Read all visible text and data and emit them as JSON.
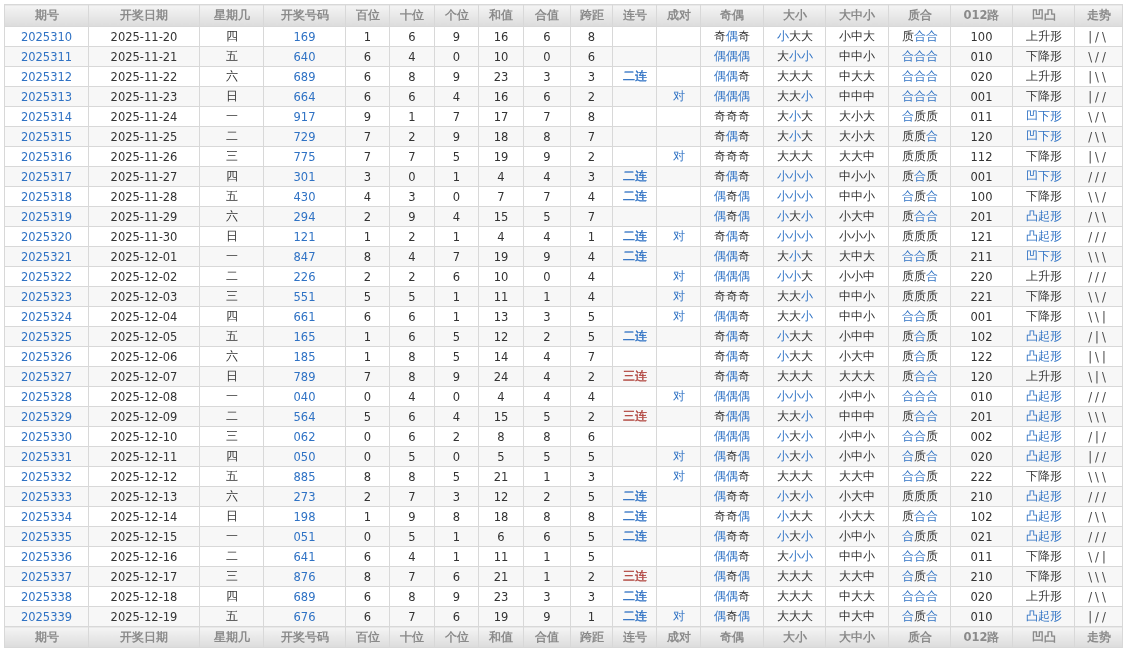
{
  "columns": [
    "期号",
    "开奖日期",
    "星期几",
    "开奖号码",
    "百位",
    "十位",
    "个位",
    "和值",
    "合值",
    "跨距",
    "连号",
    "成对",
    "奇偶",
    "大小",
    "大中小",
    "质合",
    "012路",
    "凹凸",
    "走势"
  ],
  "rows": [
    {
      "issue": "2025310",
      "date": "2025-11-20",
      "weekday": "四",
      "number": "169",
      "hundreds": "1",
      "tens": "6",
      "ones": "9",
      "sum": "16",
      "sum_tail": "6",
      "span": "8",
      "parity": [
        "奇",
        "偶",
        "奇"
      ],
      "parity_hl": [
        false,
        true,
        false
      ],
      "size": [
        "小",
        "大",
        "大"
      ],
      "size_hl": [
        true,
        false,
        false
      ],
      "big_mid_small": "小中大",
      "prime": [
        "质",
        "合",
        "合"
      ],
      "prime_hl": [
        false,
        true,
        true
      ],
      "road": "100",
      "shape": "上升形",
      "shape_hl": false,
      "trend": "|/\\"
    },
    {
      "issue": "2025311",
      "date": "2025-11-21",
      "weekday": "五",
      "number": "640",
      "hundreds": "6",
      "tens": "4",
      "ones": "0",
      "sum": "10",
      "sum_tail": "0",
      "span": "6",
      "parity": [
        "偶",
        "偶",
        "偶"
      ],
      "parity_hl": [
        true,
        true,
        true
      ],
      "size": [
        "大",
        "小",
        "小"
      ],
      "size_hl": [
        false,
        true,
        true
      ],
      "big_mid_small": "中中小",
      "prime": [
        "合",
        "合",
        "合"
      ],
      "prime_hl": [
        true,
        true,
        true
      ],
      "road": "010",
      "shape": "下降形",
      "shape_hl": false,
      "trend": "\\//"
    },
    {
      "issue": "2025312",
      "date": "2025-11-22",
      "weekday": "六",
      "number": "689",
      "hundreds": "6",
      "tens": "8",
      "ones": "9",
      "sum": "23",
      "sum_tail": "3",
      "span": "3",
      "consecutive": {
        "text": "二连",
        "color": "#2f72c4"
      },
      "parity": [
        "偶",
        "偶",
        "奇"
      ],
      "parity_hl": [
        true,
        true,
        false
      ],
      "size": [
        "大",
        "大",
        "大"
      ],
      "size_hl": [
        false,
        false,
        false
      ],
      "big_mid_small": "中大大",
      "prime": [
        "合",
        "合",
        "合"
      ],
      "prime_hl": [
        true,
        true,
        true
      ],
      "road": "020",
      "shape": "上升形",
      "shape_hl": false,
      "trend": "|\\\\"
    },
    {
      "issue": "2025313",
      "date": "2025-11-23",
      "weekday": "日",
      "number": "664",
      "hundreds": "6",
      "tens": "6",
      "ones": "4",
      "sum": "16",
      "sum_tail": "6",
      "span": "2",
      "pair": "对",
      "parity": [
        "偶",
        "偶",
        "偶"
      ],
      "parity_hl": [
        true,
        true,
        true
      ],
      "size": [
        "大",
        "大",
        "小"
      ],
      "size_hl": [
        false,
        false,
        true
      ],
      "big_mid_small": "中中中",
      "prime": [
        "合",
        "合",
        "合"
      ],
      "prime_hl": [
        true,
        true,
        true
      ],
      "road": "001",
      "shape": "下降形",
      "shape_hl": false,
      "trend": "|//"
    },
    {
      "issue": "2025314",
      "date": "2025-11-24",
      "weekday": "一",
      "number": "917",
      "hundreds": "9",
      "tens": "1",
      "ones": "7",
      "sum": "17",
      "sum_tail": "7",
      "span": "8",
      "parity": [
        "奇",
        "奇",
        "奇"
      ],
      "parity_hl": [
        false,
        false,
        false
      ],
      "size": [
        "大",
        "小",
        "大"
      ],
      "size_hl": [
        false,
        true,
        false
      ],
      "big_mid_small": "大小大",
      "prime": [
        "合",
        "质",
        "质"
      ],
      "prime_hl": [
        true,
        false,
        false
      ],
      "road": "011",
      "shape": "凹下形",
      "shape_hl": true,
      "trend": "\\/\\"
    },
    {
      "issue": "2025315",
      "date": "2025-11-25",
      "weekday": "二",
      "number": "729",
      "hundreds": "7",
      "tens": "2",
      "ones": "9",
      "sum": "18",
      "sum_tail": "8",
      "span": "7",
      "parity": [
        "奇",
        "偶",
        "奇"
      ],
      "parity_hl": [
        false,
        true,
        false
      ],
      "size": [
        "大",
        "小",
        "大"
      ],
      "size_hl": [
        false,
        true,
        false
      ],
      "big_mid_small": "大小大",
      "prime": [
        "质",
        "质",
        "合"
      ],
      "prime_hl": [
        false,
        false,
        true
      ],
      "road": "120",
      "shape": "凹下形",
      "shape_hl": true,
      "trend": "/\\\\"
    },
    {
      "issue": "2025316",
      "date": "2025-11-26",
      "weekday": "三",
      "number": "775",
      "hundreds": "7",
      "tens": "7",
      "ones": "5",
      "sum": "19",
      "sum_tail": "9",
      "span": "2",
      "pair": "对",
      "parity": [
        "奇",
        "奇",
        "奇"
      ],
      "parity_hl": [
        false,
        false,
        false
      ],
      "size": [
        "大",
        "大",
        "大"
      ],
      "size_hl": [
        false,
        false,
        false
      ],
      "big_mid_small": "大大中",
      "prime": [
        "质",
        "质",
        "质"
      ],
      "prime_hl": [
        false,
        false,
        false
      ],
      "road": "112",
      "shape": "下降形",
      "shape_hl": false,
      "trend": "|\\/"
    },
    {
      "issue": "2025317",
      "date": "2025-11-27",
      "weekday": "四",
      "number": "301",
      "hundreds": "3",
      "tens": "0",
      "ones": "1",
      "sum": "4",
      "sum_tail": "4",
      "span": "3",
      "consecutive": {
        "text": "二连",
        "color": "#2f72c4"
      },
      "parity": [
        "奇",
        "偶",
        "奇"
      ],
      "parity_hl": [
        false,
        true,
        false
      ],
      "size": [
        "小",
        "小",
        "小"
      ],
      "size_hl": [
        true,
        true,
        true
      ],
      "big_mid_small": "中小小",
      "prime": [
        "质",
        "合",
        "质"
      ],
      "prime_hl": [
        false,
        true,
        false
      ],
      "road": "001",
      "shape": "凹下形",
      "shape_hl": true,
      "trend": "///"
    },
    {
      "issue": "2025318",
      "date": "2025-11-28",
      "weekday": "五",
      "number": "430",
      "hundreds": "4",
      "tens": "3",
      "ones": "0",
      "sum": "7",
      "sum_tail": "7",
      "span": "4",
      "consecutive": {
        "text": "二连",
        "color": "#2f72c4"
      },
      "parity": [
        "偶",
        "奇",
        "偶"
      ],
      "parity_hl": [
        true,
        false,
        true
      ],
      "size": [
        "小",
        "小",
        "小"
      ],
      "size_hl": [
        true,
        true,
        true
      ],
      "big_mid_small": "中中小",
      "prime": [
        "合",
        "质",
        "合"
      ],
      "prime_hl": [
        true,
        false,
        true
      ],
      "road": "100",
      "shape": "下降形",
      "shape_hl": false,
      "trend": "\\\\/"
    },
    {
      "issue": "2025319",
      "date": "2025-11-29",
      "weekday": "六",
      "number": "294",
      "hundreds": "2",
      "tens": "9",
      "ones": "4",
      "sum": "15",
      "sum_tail": "5",
      "span": "7",
      "parity": [
        "偶",
        "奇",
        "偶"
      ],
      "parity_hl": [
        true,
        false,
        true
      ],
      "size": [
        "小",
        "大",
        "小"
      ],
      "size_hl": [
        true,
        false,
        true
      ],
      "big_mid_small": "小大中",
      "prime": [
        "质",
        "合",
        "合"
      ],
      "prime_hl": [
        false,
        true,
        true
      ],
      "road": "201",
      "shape": "凸起形",
      "shape_hl": true,
      "trend": "/\\\\"
    },
    {
      "issue": "2025320",
      "date": "2025-11-30",
      "weekday": "日",
      "number": "121",
      "hundreds": "1",
      "tens": "2",
      "ones": "1",
      "sum": "4",
      "sum_tail": "4",
      "span": "1",
      "consecutive": {
        "text": "二连",
        "color": "#2f72c4"
      },
      "pair": "对",
      "parity": [
        "奇",
        "偶",
        "奇"
      ],
      "parity_hl": [
        false,
        true,
        false
      ],
      "size": [
        "小",
        "小",
        "小"
      ],
      "size_hl": [
        true,
        true,
        true
      ],
      "big_mid_small": "小小小",
      "prime": [
        "质",
        "质",
        "质"
      ],
      "prime_hl": [
        false,
        false,
        false
      ],
      "road": "121",
      "shape": "凸起形",
      "shape_hl": true,
      "trend": "///"
    },
    {
      "issue": "2025321",
      "date": "2025-12-01",
      "weekday": "一",
      "number": "847",
      "hundreds": "8",
      "tens": "4",
      "ones": "7",
      "sum": "19",
      "sum_tail": "9",
      "span": "4",
      "consecutive": {
        "text": "二连",
        "color": "#2f72c4"
      },
      "parity": [
        "偶",
        "偶",
        "奇"
      ],
      "parity_hl": [
        true,
        true,
        false
      ],
      "size": [
        "大",
        "小",
        "大"
      ],
      "size_hl": [
        false,
        true,
        false
      ],
      "big_mid_small": "大中大",
      "prime": [
        "合",
        "合",
        "质"
      ],
      "prime_hl": [
        true,
        true,
        false
      ],
      "road": "211",
      "shape": "凹下形",
      "shape_hl": true,
      "trend": "\\\\\\"
    },
    {
      "issue": "2025322",
      "date": "2025-12-02",
      "weekday": "二",
      "number": "226",
      "hundreds": "2",
      "tens": "2",
      "ones": "6",
      "sum": "10",
      "sum_tail": "0",
      "span": "4",
      "pair": "对",
      "parity": [
        "偶",
        "偶",
        "偶"
      ],
      "parity_hl": [
        true,
        true,
        true
      ],
      "size": [
        "小",
        "小",
        "大"
      ],
      "size_hl": [
        true,
        true,
        false
      ],
      "big_mid_small": "小小中",
      "prime": [
        "质",
        "质",
        "合"
      ],
      "prime_hl": [
        false,
        false,
        true
      ],
      "road": "220",
      "shape": "上升形",
      "shape_hl": false,
      "trend": "///"
    },
    {
      "issue": "2025323",
      "date": "2025-12-03",
      "weekday": "三",
      "number": "551",
      "hundreds": "5",
      "tens": "5",
      "ones": "1",
      "sum": "11",
      "sum_tail": "1",
      "span": "4",
      "pair": "对",
      "parity": [
        "奇",
        "奇",
        "奇"
      ],
      "parity_hl": [
        false,
        false,
        false
      ],
      "size": [
        "大",
        "大",
        "小"
      ],
      "size_hl": [
        false,
        false,
        true
      ],
      "big_mid_small": "中中小",
      "prime": [
        "质",
        "质",
        "质"
      ],
      "prime_hl": [
        false,
        false,
        false
      ],
      "road": "221",
      "shape": "下降形",
      "shape_hl": false,
      "trend": "\\\\/"
    },
    {
      "issue": "2025324",
      "date": "2025-12-04",
      "weekday": "四",
      "number": "661",
      "hundreds": "6",
      "tens": "6",
      "ones": "1",
      "sum": "13",
      "sum_tail": "3",
      "span": "5",
      "pair": "对",
      "parity": [
        "偶",
        "偶",
        "奇"
      ],
      "parity_hl": [
        true,
        true,
        false
      ],
      "size": [
        "大",
        "大",
        "小"
      ],
      "size_hl": [
        false,
        false,
        true
      ],
      "big_mid_small": "中中小",
      "prime": [
        "合",
        "合",
        "质"
      ],
      "prime_hl": [
        true,
        true,
        false
      ],
      "road": "001",
      "shape": "下降形",
      "shape_hl": false,
      "trend": "\\\\|"
    },
    {
      "issue": "2025325",
      "date": "2025-12-05",
      "weekday": "五",
      "number": "165",
      "hundreds": "1",
      "tens": "6",
      "ones": "5",
      "sum": "12",
      "sum_tail": "2",
      "span": "5",
      "consecutive": {
        "text": "二连",
        "color": "#2f72c4"
      },
      "parity": [
        "奇",
        "偶",
        "奇"
      ],
      "parity_hl": [
        false,
        true,
        false
      ],
      "size": [
        "小",
        "大",
        "大"
      ],
      "size_hl": [
        true,
        false,
        false
      ],
      "big_mid_small": "小中中",
      "prime": [
        "质",
        "合",
        "质"
      ],
      "prime_hl": [
        false,
        true,
        false
      ],
      "road": "102",
      "shape": "凸起形",
      "shape_hl": true,
      "trend": "/|\\"
    },
    {
      "issue": "2025326",
      "date": "2025-12-06",
      "weekday": "六",
      "number": "185",
      "hundreds": "1",
      "tens": "8",
      "ones": "5",
      "sum": "14",
      "sum_tail": "4",
      "span": "7",
      "parity": [
        "奇",
        "偶",
        "奇"
      ],
      "parity_hl": [
        false,
        true,
        false
      ],
      "size": [
        "小",
        "大",
        "大"
      ],
      "size_hl": [
        true,
        false,
        false
      ],
      "big_mid_small": "小大中",
      "prime": [
        "质",
        "合",
        "质"
      ],
      "prime_hl": [
        false,
        true,
        false
      ],
      "road": "122",
      "shape": "凸起形",
      "shape_hl": true,
      "trend": "|\\|"
    },
    {
      "issue": "2025327",
      "date": "2025-12-07",
      "weekday": "日",
      "number": "789",
      "hundreds": "7",
      "tens": "8",
      "ones": "9",
      "sum": "24",
      "sum_tail": "4",
      "span": "2",
      "consecutive": {
        "text": "三连",
        "color": "#b0443e"
      },
      "parity": [
        "奇",
        "偶",
        "奇"
      ],
      "parity_hl": [
        false,
        true,
        false
      ],
      "size": [
        "大",
        "大",
        "大"
      ],
      "size_hl": [
        false,
        false,
        false
      ],
      "big_mid_small": "大大大",
      "prime": [
        "质",
        "合",
        "合"
      ],
      "prime_hl": [
        false,
        true,
        true
      ],
      "road": "120",
      "shape": "上升形",
      "shape_hl": false,
      "trend": "\\|\\"
    },
    {
      "issue": "2025328",
      "date": "2025-12-08",
      "weekday": "一",
      "number": "040",
      "hundreds": "0",
      "tens": "4",
      "ones": "0",
      "sum": "4",
      "sum_tail": "4",
      "span": "4",
      "pair": "对",
      "parity": [
        "偶",
        "偶",
        "偶"
      ],
      "parity_hl": [
        true,
        true,
        true
      ],
      "size": [
        "小",
        "小",
        "小"
      ],
      "size_hl": [
        true,
        true,
        true
      ],
      "big_mid_small": "小中小",
      "prime": [
        "合",
        "合",
        "合"
      ],
      "prime_hl": [
        true,
        true,
        true
      ],
      "road": "010",
      "shape": "凸起形",
      "shape_hl": true,
      "trend": "///"
    },
    {
      "issue": "2025329",
      "date": "2025-12-09",
      "weekday": "二",
      "number": "564",
      "hundreds": "5",
      "tens": "6",
      "ones": "4",
      "sum": "15",
      "sum_tail": "5",
      "span": "2",
      "consecutive": {
        "text": "三连",
        "color": "#b0443e"
      },
      "parity": [
        "奇",
        "偶",
        "偶"
      ],
      "parity_hl": [
        false,
        true,
        true
      ],
      "size": [
        "大",
        "大",
        "小"
      ],
      "size_hl": [
        false,
        false,
        true
      ],
      "big_mid_small": "中中中",
      "prime": [
        "质",
        "合",
        "合"
      ],
      "prime_hl": [
        false,
        true,
        true
      ],
      "road": "201",
      "shape": "凸起形",
      "shape_hl": true,
      "trend": "\\\\\\"
    },
    {
      "issue": "2025330",
      "date": "2025-12-10",
      "weekday": "三",
      "number": "062",
      "hundreds": "0",
      "tens": "6",
      "ones": "2",
      "sum": "8",
      "sum_tail": "8",
      "span": "6",
      "parity": [
        "偶",
        "偶",
        "偶"
      ],
      "parity_hl": [
        true,
        true,
        true
      ],
      "size": [
        "小",
        "大",
        "小"
      ],
      "size_hl": [
        true,
        false,
        true
      ],
      "big_mid_small": "小中小",
      "prime": [
        "合",
        "合",
        "质"
      ],
      "prime_hl": [
        true,
        true,
        false
      ],
      "road": "002",
      "shape": "凸起形",
      "shape_hl": true,
      "trend": "/|/"
    },
    {
      "issue": "2025331",
      "date": "2025-12-11",
      "weekday": "四",
      "number": "050",
      "hundreds": "0",
      "tens": "5",
      "ones": "0",
      "sum": "5",
      "sum_tail": "5",
      "span": "5",
      "pair": "对",
      "parity": [
        "偶",
        "奇",
        "偶"
      ],
      "parity_hl": [
        true,
        false,
        true
      ],
      "size": [
        "小",
        "大",
        "小"
      ],
      "size_hl": [
        true,
        false,
        true
      ],
      "big_mid_small": "小中小",
      "prime": [
        "合",
        "质",
        "合"
      ],
      "prime_hl": [
        true,
        false,
        true
      ],
      "road": "020",
      "shape": "凸起形",
      "shape_hl": true,
      "trend": "|//"
    },
    {
      "issue": "2025332",
      "date": "2025-12-12",
      "weekday": "五",
      "number": "885",
      "hundreds": "8",
      "tens": "8",
      "ones": "5",
      "sum": "21",
      "sum_tail": "1",
      "span": "3",
      "pair": "对",
      "parity": [
        "偶",
        "偶",
        "奇"
      ],
      "parity_hl": [
        true,
        true,
        false
      ],
      "size": [
        "大",
        "大",
        "大"
      ],
      "size_hl": [
        false,
        false,
        false
      ],
      "big_mid_small": "大大中",
      "prime": [
        "合",
        "合",
        "质"
      ],
      "prime_hl": [
        true,
        true,
        false
      ],
      "road": "222",
      "shape": "下降形",
      "shape_hl": false,
      "trend": "\\\\\\"
    },
    {
      "issue": "2025333",
      "date": "2025-12-13",
      "weekday": "六",
      "number": "273",
      "hundreds": "2",
      "tens": "7",
      "ones": "3",
      "sum": "12",
      "sum_tail": "2",
      "span": "5",
      "consecutive": {
        "text": "二连",
        "color": "#2f72c4"
      },
      "parity": [
        "偶",
        "奇",
        "奇"
      ],
      "parity_hl": [
        true,
        false,
        false
      ],
      "size": [
        "小",
        "大",
        "小"
      ],
      "size_hl": [
        true,
        false,
        true
      ],
      "big_mid_small": "小大中",
      "prime": [
        "质",
        "质",
        "质"
      ],
      "prime_hl": [
        false,
        false,
        false
      ],
      "road": "210",
      "shape": "凸起形",
      "shape_hl": true,
      "trend": "///"
    },
    {
      "issue": "2025334",
      "date": "2025-12-14",
      "weekday": "日",
      "number": "198",
      "hundreds": "1",
      "tens": "9",
      "ones": "8",
      "sum": "18",
      "sum_tail": "8",
      "span": "8",
      "consecutive": {
        "text": "二连",
        "color": "#2f72c4"
      },
      "parity": [
        "奇",
        "奇",
        "偶"
      ],
      "parity_hl": [
        false,
        false,
        true
      ],
      "size": [
        "小",
        "大",
        "大"
      ],
      "size_hl": [
        true,
        false,
        false
      ],
      "big_mid_small": "小大大",
      "prime": [
        "质",
        "合",
        "合"
      ],
      "prime_hl": [
        false,
        true,
        true
      ],
      "road": "102",
      "shape": "凸起形",
      "shape_hl": true,
      "trend": "/\\\\"
    },
    {
      "issue": "2025335",
      "date": "2025-12-15",
      "weekday": "一",
      "number": "051",
      "hundreds": "0",
      "tens": "5",
      "ones": "1",
      "sum": "6",
      "sum_tail": "6",
      "span": "5",
      "consecutive": {
        "text": "二连",
        "color": "#2f72c4"
      },
      "parity": [
        "偶",
        "奇",
        "奇"
      ],
      "parity_hl": [
        true,
        false,
        false
      ],
      "size": [
        "小",
        "大",
        "小"
      ],
      "size_hl": [
        true,
        false,
        true
      ],
      "big_mid_small": "小中小",
      "prime": [
        "合",
        "质",
        "质"
      ],
      "prime_hl": [
        true,
        false,
        false
      ],
      "road": "021",
      "shape": "凸起形",
      "shape_hl": true,
      "trend": "///"
    },
    {
      "issue": "2025336",
      "date": "2025-12-16",
      "weekday": "二",
      "number": "641",
      "hundreds": "6",
      "tens": "4",
      "ones": "1",
      "sum": "11",
      "sum_tail": "1",
      "span": "5",
      "parity": [
        "偶",
        "偶",
        "奇"
      ],
      "parity_hl": [
        true,
        true,
        false
      ],
      "size": [
        "大",
        "小",
        "小"
      ],
      "size_hl": [
        false,
        true,
        true
      ],
      "big_mid_small": "中中小",
      "prime": [
        "合",
        "合",
        "质"
      ],
      "prime_hl": [
        true,
        true,
        false
      ],
      "road": "011",
      "shape": "下降形",
      "shape_hl": false,
      "trend": "\\/|"
    },
    {
      "issue": "2025337",
      "date": "2025-12-17",
      "weekday": "三",
      "number": "876",
      "hundreds": "8",
      "tens": "7",
      "ones": "6",
      "sum": "21",
      "sum_tail": "1",
      "span": "2",
      "consecutive": {
        "text": "三连",
        "color": "#b0443e"
      },
      "parity": [
        "偶",
        "奇",
        "偶"
      ],
      "parity_hl": [
        true,
        false,
        true
      ],
      "size": [
        "大",
        "大",
        "大"
      ],
      "size_hl": [
        false,
        false,
        false
      ],
      "big_mid_small": "大大中",
      "prime": [
        "合",
        "质",
        "合"
      ],
      "prime_hl": [
        true,
        false,
        true
      ],
      "road": "210",
      "shape": "下降形",
      "shape_hl": false,
      "trend": "\\\\\\"
    },
    {
      "issue": "2025338",
      "date": "2025-12-18",
      "weekday": "四",
      "number": "689",
      "hundreds": "6",
      "tens": "8",
      "ones": "9",
      "sum": "23",
      "sum_tail": "3",
      "span": "3",
      "consecutive": {
        "text": "二连",
        "color": "#2f72c4"
      },
      "parity": [
        "偶",
        "偶",
        "奇"
      ],
      "parity_hl": [
        true,
        true,
        false
      ],
      "size": [
        "大",
        "大",
        "大"
      ],
      "size_hl": [
        false,
        false,
        false
      ],
      "big_mid_small": "中大大",
      "prime": [
        "合",
        "合",
        "合"
      ],
      "prime_hl": [
        true,
        true,
        true
      ],
      "road": "020",
      "shape": "上升形",
      "shape_hl": false,
      "trend": "/\\\\"
    },
    {
      "issue": "2025339",
      "date": "2025-12-19",
      "weekday": "五",
      "number": "676",
      "hundreds": "6",
      "tens": "7",
      "ones": "6",
      "sum": "19",
      "sum_tail": "9",
      "span": "1",
      "consecutive": {
        "text": "二连",
        "color": "#2f72c4"
      },
      "pair": "对",
      "parity": [
        "偶",
        "奇",
        "偶"
      ],
      "parity_hl": [
        true,
        false,
        true
      ],
      "size": [
        "大",
        "大",
        "大"
      ],
      "size_hl": [
        false,
        false,
        false
      ],
      "big_mid_small": "中大中",
      "prime": [
        "合",
        "质",
        "合"
      ],
      "prime_hl": [
        true,
        false,
        true
      ],
      "road": "010",
      "shape": "凸起形",
      "shape_hl": true,
      "trend": "|//"
    }
  ],
  "footer_columns": [
    "期号",
    "开奖日期",
    "星期几",
    "开奖号码",
    "百位",
    "十位",
    "个位",
    "和值",
    "合值",
    "跨距",
    "连号",
    "成对",
    "奇偶",
    "大小",
    "大中小",
    "质合",
    "012路",
    "凹凸",
    "走势"
  ]
}
